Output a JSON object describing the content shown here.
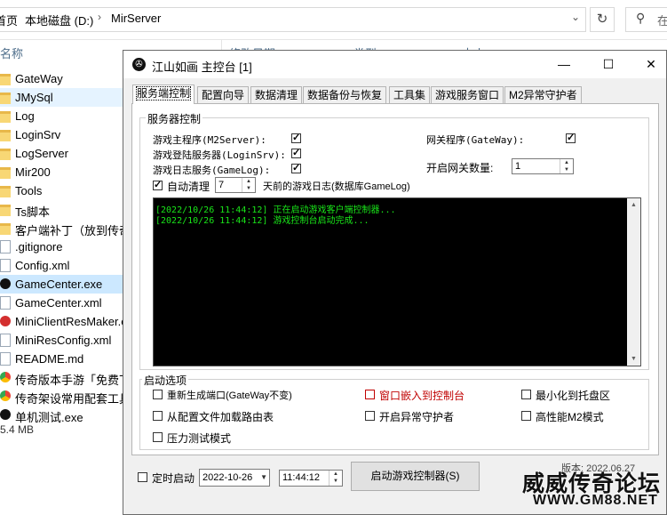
{
  "explorer": {
    "breadcrumb": [
      "首页",
      "本地磁盘 (D:)",
      "MirServer"
    ],
    "search_placeholder": "在",
    "columns": [
      "名称",
      "修改日期",
      "类型",
      "大小"
    ],
    "files": [
      {
        "name": "GateWay",
        "icon": "folder-icon"
      },
      {
        "name": "JMySql",
        "icon": "folder-icon"
      },
      {
        "name": "Log",
        "icon": "folder-icon"
      },
      {
        "name": "LoginSrv",
        "icon": "folder-icon"
      },
      {
        "name": "LogServer",
        "icon": "folder-icon"
      },
      {
        "name": "Mir200",
        "icon": "folder-icon"
      },
      {
        "name": "Tools",
        "icon": "folder-icon"
      },
      {
        "name": "Ts脚本",
        "icon": "folder-icon"
      },
      {
        "name": "客户端补丁（放到传奇",
        "icon": "folder-icon"
      },
      {
        "name": ".gitignore",
        "icon": "file-icon"
      },
      {
        "name": "Config.xml",
        "icon": "file-icon"
      },
      {
        "name": "GameCenter.exe",
        "icon": "app-icon"
      },
      {
        "name": "GameCenter.xml",
        "icon": "file-icon"
      },
      {
        "name": "MiniClientResMaker.e",
        "icon": "app-icon"
      },
      {
        "name": "MiniResConfig.xml",
        "icon": "file-icon"
      },
      {
        "name": "README.md",
        "icon": "file-icon"
      },
      {
        "name": "传奇版本手游「免费下",
        "icon": "browser-icon"
      },
      {
        "name": "传奇架设常用配套工具",
        "icon": "browser-icon"
      },
      {
        "name": "单机测试.exe",
        "icon": "app-icon"
      }
    ],
    "status": "5.4 MB"
  },
  "window": {
    "title": "江山如画 主控台 [1]",
    "minimize": "—",
    "maximize": "☐",
    "close": "✕"
  },
  "tabs": [
    "服务端控制",
    "配置向导",
    "数据清理",
    "数据备份与恢复",
    "工具集",
    "游戏服务窗口",
    "M2异常守护者"
  ],
  "server_control": {
    "group_label": "服务器控制",
    "m2server_label": "游戏主程序(M2Server):",
    "m2server_checked": true,
    "loginsrv_label": "游戏登陆服务器(LoginSrv):",
    "loginsrv_checked": true,
    "gamelog_label": "游戏日志服务(GameLog):",
    "gamelog_checked": true,
    "gateway_label": "网关程序(GateWay):",
    "gateway_checked": true,
    "gateway_count_label": "开启网关数量:",
    "gateway_count": "1",
    "auto_clean_label": "自动清理",
    "auto_clean_checked": true,
    "auto_clean_days": "7",
    "auto_clean_suffix": "天前的游戏日志(数据库GameLog)"
  },
  "log": [
    "[2022/10/26 11:44:12] 正在启动游戏客户端控制器...",
    "[2022/10/26 11:44:12] 游戏控制台启动完成..."
  ],
  "startup_options": {
    "group_label": "启动选项",
    "regen_ports": "重新生成端口(GateWay不变)",
    "load_routes": "从配置文件加载路由表",
    "stress_test": "压力测试模式",
    "embed_window": "窗口嵌入到控制台",
    "exception_guard": "开启异常守护者",
    "minimize_tray": "最小化到托盘区",
    "high_perf_m2": "高性能M2模式",
    "embed_color": "#c00000"
  },
  "bottom": {
    "timer_label": "定时启动",
    "date": "2022-10-26",
    "time": "11:44:12",
    "start_button": "启动游戏控制器(S)",
    "version": "版本: 2022.06.27"
  },
  "watermark": {
    "text": "威威传奇论坛",
    "url": "WWW.GM88.NET"
  }
}
